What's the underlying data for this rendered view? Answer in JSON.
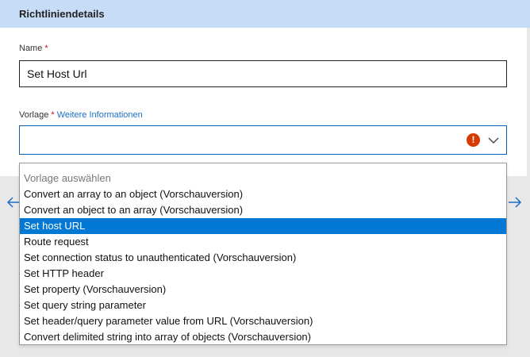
{
  "panel": {
    "title": "Richtliniendetails"
  },
  "name_field": {
    "label": "Name",
    "required_mark": " *",
    "value": "Set Host Url"
  },
  "template_field": {
    "label": "Vorlage",
    "required_mark": " *",
    "more_info_link": " Weitere Informationen",
    "value": "",
    "error_icon_glyph": "!",
    "icons": [
      "error-icon",
      "chevron-down-icon"
    ]
  },
  "navigation": {
    "icons": [
      "arrow-left-icon",
      "arrow-right-icon"
    ]
  },
  "dropdown": {
    "placeholder": "Vorlage auswählen",
    "selected_index": 2,
    "options": [
      "Convert an array to an object (Vorschauversion)",
      "Convert an object to an array (Vorschauversion)",
      "Set host URL",
      "Route request",
      "Set connection status to unauthenticated (Vorschauversion)",
      "Set HTTP header",
      "Set property (Vorschauversion)",
      "Set query string parameter",
      "Set header/query parameter value from URL (Vorschauversion)",
      "Convert delimited string into array of objects (Vorschauversion)"
    ]
  },
  "colors": {
    "header_bg": "#c7dcf7",
    "accent": "#0078d4",
    "error": "#d83b01",
    "required": "#c50f1f",
    "link": "#1a6fc9"
  }
}
